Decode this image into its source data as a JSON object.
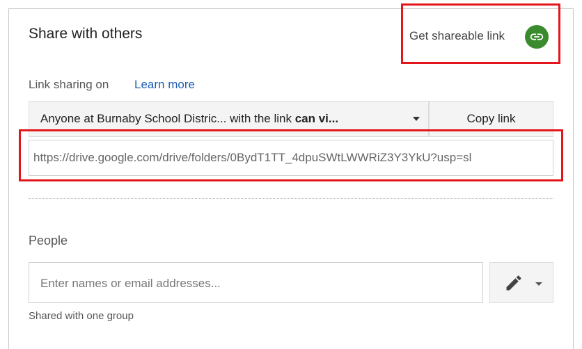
{
  "dialog": {
    "title": "Share with others",
    "get_link_label": "Get shareable link",
    "link_icon": "link-icon"
  },
  "link_sharing": {
    "status": "Link sharing on",
    "learn_more": "Learn more",
    "access_org": "Anyone at Burnaby School Distric...",
    "access_mid": " with the link ",
    "access_perm": "can vi...",
    "copy_label": "Copy link",
    "url": "https://drive.google.com/drive/folders/0BydT1TT_4dpuSWtLWWRiZ3Y3YkU?usp=sl"
  },
  "people": {
    "label": "People",
    "placeholder": "Enter names or email addresses...",
    "permission_icon": "pencil-icon",
    "shared_note": "Shared with one group"
  },
  "colors": {
    "highlight": "#e3161b",
    "link_badge": "#3a8a2e",
    "learn_more": "#1f5fb4"
  }
}
